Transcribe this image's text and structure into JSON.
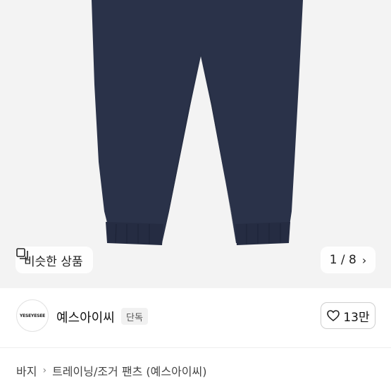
{
  "similar": {
    "label": "비슷한 상품",
    "icon": "similar-items-icon"
  },
  "gallery": {
    "counter": "1 / 8",
    "next_icon": "chevron-right-icon"
  },
  "seller": {
    "logo_text": "YESEYESEE",
    "name": "예스아이씨",
    "badge": "단독"
  },
  "likes": {
    "count": "13만",
    "icon": "heart-icon"
  },
  "breadcrumb": {
    "level1": "바지",
    "level2": "트레이닝/조거 팬츠 (예스아이씨)"
  },
  "colors": {
    "product": "#2a3249",
    "hero_bg": "#f3f3f3"
  }
}
